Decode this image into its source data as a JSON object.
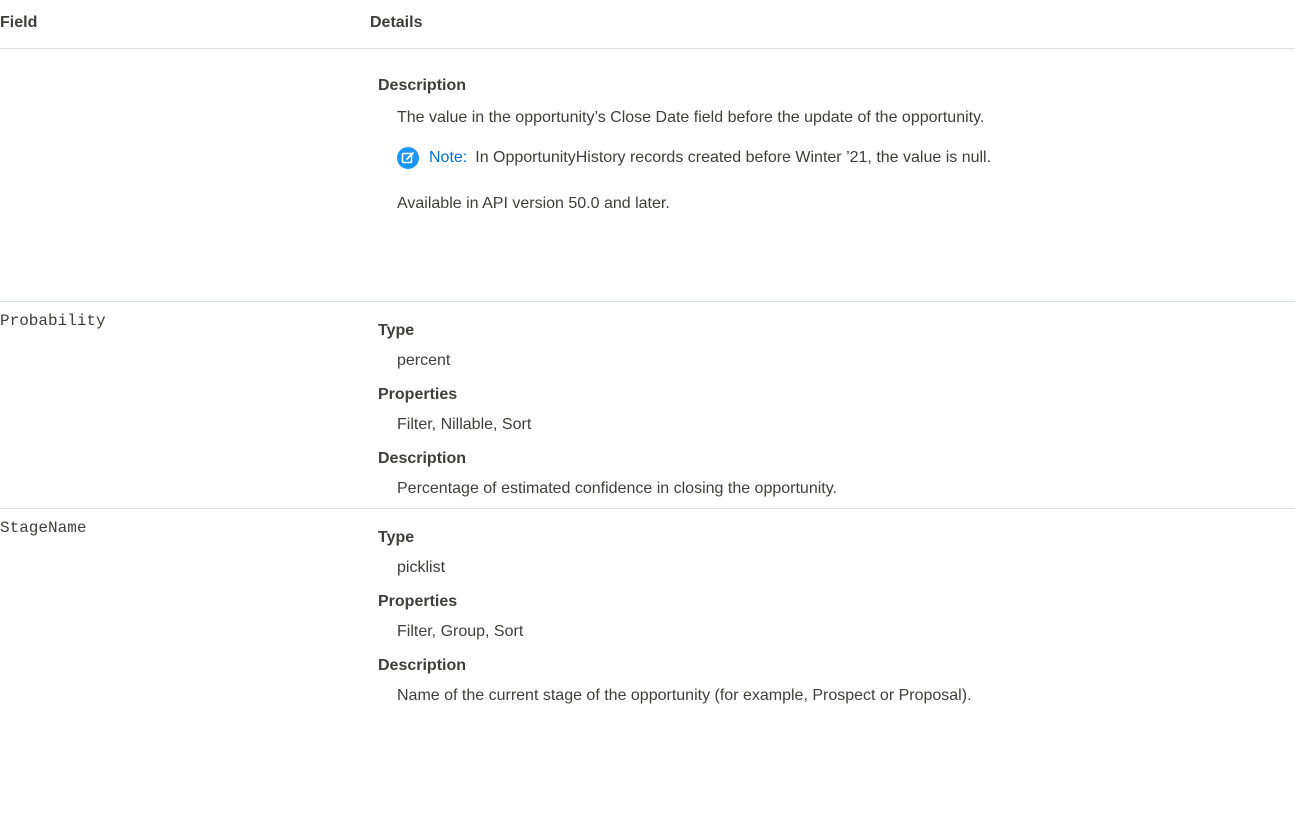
{
  "header": {
    "field_label": "Field",
    "details_label": "Details"
  },
  "rows": [
    {
      "field": "",
      "description_label": "Description",
      "description": "The value in the opportunity’s Close Date field before the update of the opportunity.",
      "note_label": "Note:",
      "note_text": "In OpportunityHistory records created before Winter ’21, the value is null.",
      "availability": "Available in API version 50.0 and later."
    },
    {
      "field": "Probability",
      "type_label": "Type",
      "type": "percent",
      "properties_label": "Properties",
      "properties": "Filter, Nillable, Sort",
      "description_label": "Description",
      "description": "Percentage of estimated confidence in closing the opportunity."
    },
    {
      "field": "StageName",
      "type_label": "Type",
      "type": "picklist",
      "properties_label": "Properties",
      "properties": "Filter, Group, Sort",
      "description_label": "Description",
      "description": "Name of the current stage of the opportunity (for example, Prospect or Proposal)."
    }
  ],
  "icons": {
    "note_icon": "edit-note-icon",
    "note_icon_color": "#1b96ff",
    "note_label_color": "#0070d2"
  }
}
